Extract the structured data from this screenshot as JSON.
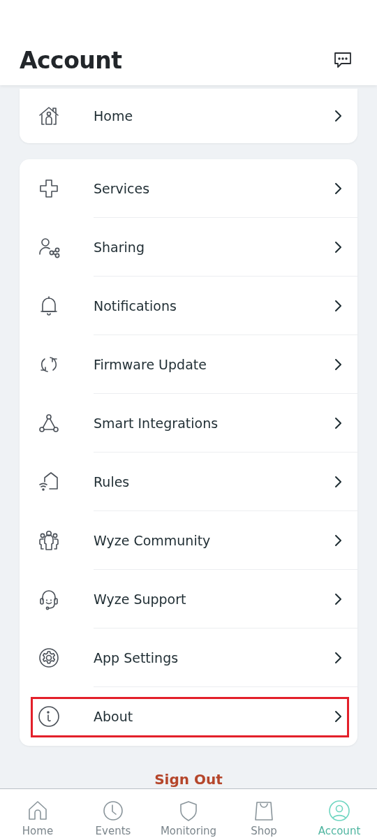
{
  "header": {
    "title": "Account"
  },
  "sections": [
    {
      "items": [
        {
          "label": "Home",
          "highlighted": false
        }
      ]
    },
    {
      "items": [
        {
          "label": "Services",
          "highlighted": false
        },
        {
          "label": "Sharing",
          "highlighted": false
        },
        {
          "label": "Notifications",
          "highlighted": false
        },
        {
          "label": "Firmware Update",
          "highlighted": false
        },
        {
          "label": "Smart Integrations",
          "highlighted": false
        },
        {
          "label": "Rules",
          "highlighted": false
        },
        {
          "label": "Wyze Community",
          "highlighted": false
        },
        {
          "label": "Wyze Support",
          "highlighted": false
        },
        {
          "label": "App Settings",
          "highlighted": false
        },
        {
          "label": "About",
          "highlighted": true
        }
      ]
    }
  ],
  "sign_out": "Sign Out",
  "tabs": [
    {
      "label": "Home",
      "selected": false
    },
    {
      "label": "Events",
      "selected": false
    },
    {
      "label": "Monitoring",
      "selected": false
    },
    {
      "label": "Shop",
      "selected": false
    },
    {
      "label": "Account",
      "selected": true
    }
  ]
}
